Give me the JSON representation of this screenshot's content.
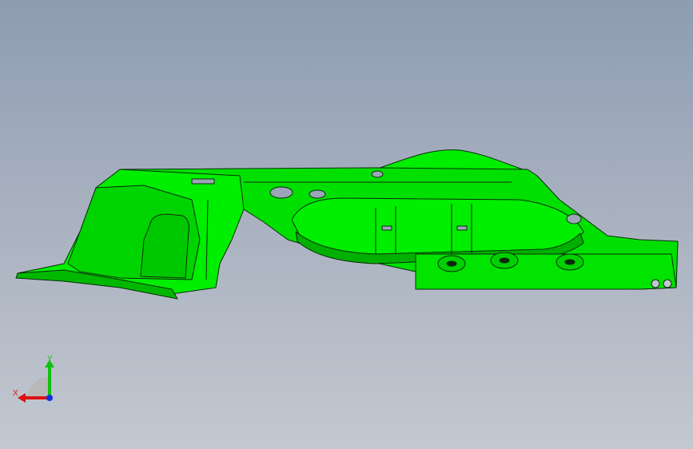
{
  "viewport": {
    "background_top": "#8e9cb2",
    "background_bottom": "#c3c8d0"
  },
  "model": {
    "color": "#00ee00",
    "shade_color": "#00b800",
    "edge_color": "#0a2a0a"
  },
  "triad": {
    "x_label": "X",
    "y_label": "Y",
    "x_color": "#e01010",
    "y_color": "#10c010",
    "z_color": "#1030e0"
  }
}
